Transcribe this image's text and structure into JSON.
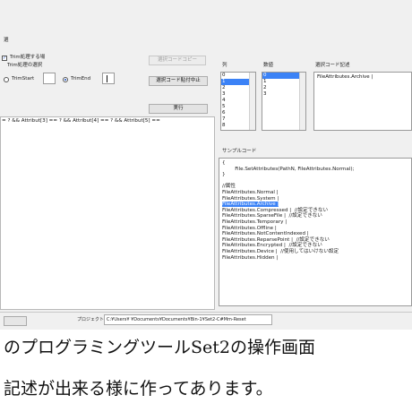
{
  "window": {
    "group_label": "選",
    "trim_checkbox_label": "Trim処理する場",
    "trim_choice_label": "Trim処理の選択",
    "trim_start_label": "TrimStart",
    "trim_start_value": "",
    "trim_end_label": "TrimEnd",
    "trim_end_value": "",
    "copy_code_button": "選択コードコピー",
    "paste_code_button": "選択コード貼付中止",
    "execute_button": "実行",
    "expression_text": "= ? && Attribut[3] == ? && Attribut[4] == ? && Attribut[5] ==",
    "column_label": "列",
    "count_label": "数値",
    "selected_code_label": "選択コード記述",
    "selected_code_value": "FileAttributes.Archive |",
    "column_list": [
      "0",
      "1",
      "2",
      "3",
      "4",
      "5",
      "6",
      "7",
      "8"
    ],
    "column_selected_index": 1,
    "count_list": [
      "0",
      "1",
      "2",
      "3"
    ],
    "count_selected_index": 0,
    "sample_code_label": "サンプルコード",
    "sample_code_lines": [
      "{",
      "        File.SetAttributes(PathN, FileAttributes.Normal);",
      "}",
      "",
      "//属性",
      "FileAttributes.Normal |",
      "FileAttributes.System |",
      "FileAttributes.Archive |",
      "FileAttributes.Compressed |  //設定できない",
      "FileAttributes.SparseFile |  //設定できない",
      "FileAttributes.Temporary |",
      "FileAttributes.Offline |",
      "FileAttributes.NotContentIndexed |",
      "FileAttributes.ReparsePoint |  //設定できない",
      "FileAttributes.Encrypted |  //設定できない",
      "FileAttributes.Device |  //使用してはいけない設定",
      "FileAttributes.Hidden |"
    ],
    "sample_code_highlight_index": 7,
    "status_label": "プロジェクトパス",
    "status_path": "C:¥Users¥   ¥Documents¥Documents¥Bin-1¥Set2-C#Mm-Reset"
  },
  "caption": {
    "line1": "のプログラミングツールSet2の操作画面",
    "line2": "記述が出来る様に作ってあります。"
  }
}
